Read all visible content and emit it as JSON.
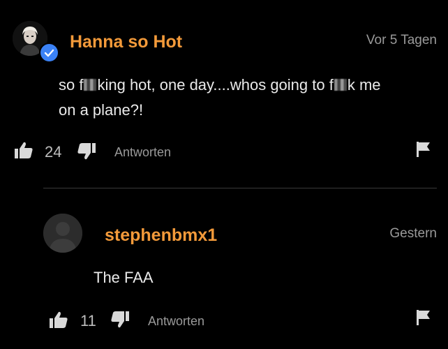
{
  "comments": [
    {
      "username": "Hanna so Hot",
      "timestamp": "Vor 5 Tagen",
      "text_parts": [
        "so f",
        "king hot, one day....whos going to f",
        "k me",
        "on a plane?!"
      ],
      "likes": "24",
      "reply_label": "Antworten",
      "verified": true
    },
    {
      "username": "stephenbmx1",
      "timestamp": "Gestern",
      "text": "The FAA",
      "likes": "11",
      "reply_label": "Antworten"
    }
  ],
  "colors": {
    "username": "#f39a3a",
    "verified_badge": "#3b82f6",
    "background": "#000000"
  },
  "icons": [
    "thumbs-up-icon",
    "thumbs-down-icon",
    "flag-icon",
    "verified-badge-icon"
  ]
}
